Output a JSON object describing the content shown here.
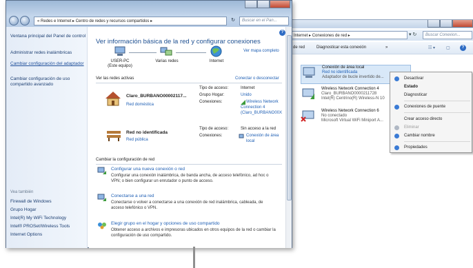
{
  "back_window": {
    "address": "Internet  ▸  Conexiones de red  ▸",
    "search_placeholder": "Buscar Conexion...",
    "toolbar": {
      "left_fragment": "de red",
      "diagnose": "Diagnosticar esta conexión",
      "more": "»"
    },
    "connections": [
      {
        "name": "Conexión de área local",
        "status": "Red no identificada",
        "adapter": "Adaptador de bucle invertido de...",
        "selected": true
      },
      {
        "name": "Wireless Network Connection 4",
        "status": "Claro_BURBANO0000211728",
        "adapter": "Intel(R) Centrino(R) Wireless-N 10"
      },
      {
        "name": "Wireless Network Connection 6",
        "status": "No conectado",
        "adapter": "Microsoft Virtual WiFi Miniport A..."
      }
    ],
    "context_menu": [
      {
        "label": "Desactivar",
        "style": "normal",
        "icon_color": "#3a7bd5"
      },
      {
        "label": "Estado",
        "style": "bold",
        "icon_color": ""
      },
      {
        "label": "Diagnosticar",
        "style": "normal",
        "icon_color": ""
      },
      {
        "label": "Conexiones de puente",
        "style": "normal",
        "icon_color": "#3a7bd5"
      },
      {
        "label": "Crear acceso directo",
        "style": "normal",
        "icon_color": ""
      },
      {
        "label": "Eliminar",
        "style": "disabled",
        "icon_color": "#b0b8c4"
      },
      {
        "label": "Cambiar nombre",
        "style": "normal",
        "icon_color": "#3a7bd5"
      },
      {
        "label": "Propiedades",
        "style": "normal",
        "icon_color": "#3a7bd5"
      }
    ]
  },
  "front_window": {
    "address": "«  Redes e Internet  ▸  Centro de redes y recursos compartidos  ▸",
    "refresh": "↻",
    "search_placeholder": "Buscar en el Pan...",
    "help_icon": "?",
    "sidebar": {
      "links": [
        {
          "label": "Ventana principal del Panel de control",
          "style": "normal"
        },
        {
          "label": "Administrar redes inalámbricas",
          "style": "normal"
        },
        {
          "label": "Cambiar configuración del adaptador",
          "style": "underline"
        },
        {
          "label": "Cambiar configuración de uso compartido avanzado",
          "style": "normal"
        }
      ],
      "see_also_title": "Vea también",
      "see_also": [
        "Firewall de Windows",
        "Grupo Hogar",
        "Intel(R) My WiFi Technology",
        "Intel® PROSet/Wireless Tools",
        "Internet Options"
      ]
    },
    "main": {
      "title": "Ver información básica de la red y configurar conexiones",
      "full_map_link": "Ver mapa completo",
      "map": [
        {
          "label": "USER-PC",
          "sub": "(Este equipo)"
        },
        {
          "label": "Varias redes",
          "sub": ""
        },
        {
          "label": "Internet",
          "sub": ""
        }
      ],
      "active_header": "Ver las redes activas",
      "connect_link": "Conectar o desconectar",
      "networks": [
        {
          "name": "Claro_BURBANO00002117...",
          "type": "Red doméstica",
          "access_label": "Tipo de acceso:",
          "access_value": "Internet",
          "group_label": "Grupo Hogar:",
          "group_value": "Unido",
          "conn_label": "Conexiones:",
          "conn_value_1": "Wireless Network",
          "conn_value_2": "Connection 4",
          "conn_value_3": "(Claro_BURBANO00X"
        },
        {
          "name": "Red no identificada",
          "type": "Red pública",
          "access_label": "Tipo de acceso:",
          "access_value": "Sin acceso a la red",
          "conn_label": "Conexiones:",
          "conn_value_1": "Conexión de área",
          "conn_value_2": "local"
        }
      ],
      "change_header": "Cambiar la configuración de red",
      "tasks": [
        {
          "title": "Configurar una nueva conexión o red",
          "desc": "Configurar una conexión inalámbrica, de banda ancha, de acceso telefónico, ad hoc o VPN; o bien configurar un enrutador o punto de acceso."
        },
        {
          "title": "Conectarse a una red",
          "desc": "Conectarse o volver a conectarse a una conexión de red inalámbrica, cableada, de acceso telefónico o VPN."
        },
        {
          "title": "Elegir grupo en el hogar y opciones de uso compartido",
          "desc": "Obtener acceso a archivos e impresoras ubicados en otros equipos de la red o cambiar la configuración de uso compartido."
        }
      ]
    }
  },
  "colors": {
    "accent": "#1f5fb4",
    "title_blue": "#1d4f91",
    "sidebar_bg": "#e4ecf7"
  }
}
